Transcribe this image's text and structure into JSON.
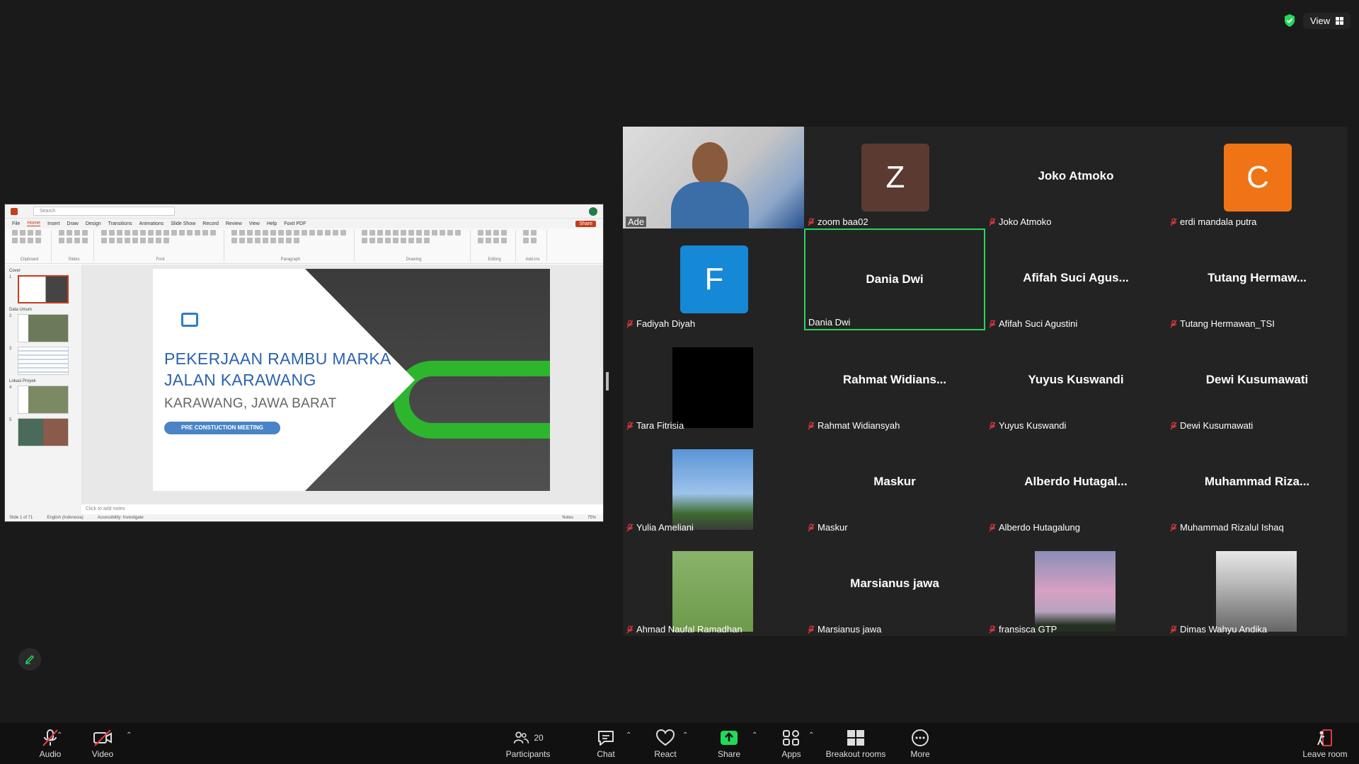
{
  "topbar": {
    "view_label": "View"
  },
  "shared_screen": {
    "app": {
      "search_placeholder": "Search",
      "tabs": [
        "File",
        "Home",
        "Insert",
        "Draw",
        "Design",
        "Transitions",
        "Animations",
        "Slide Show",
        "Record",
        "Review",
        "View",
        "Help",
        "Foxit PDF"
      ],
      "active_tab": "Home",
      "share_label": "Share",
      "ribbon_groups": [
        "Clipboard",
        "Slides",
        "Font",
        "Paragraph",
        "Drawing",
        "Editing",
        "Add-ins"
      ],
      "sections": [
        "Cover",
        "Data Umum",
        "Lokasi Proyek"
      ],
      "notes_placeholder": "Click to add notes",
      "status": {
        "slide": "Slide 1 of 71",
        "language": "English (Indonesia)",
        "accessibility": "Accessibility: Investigate",
        "notes": "Notes",
        "zoom": "75%"
      }
    },
    "slide": {
      "title_line1": "PEKERJAAN RAMBU MARKA",
      "title_line2": "JALAN KARAWANG",
      "subtitle": "KARAWANG, JAWA BARAT",
      "pill": "PRE CONSTUCTION MEETING"
    }
  },
  "participants": [
    {
      "name": "Ade",
      "type": "video",
      "muted": false
    },
    {
      "name": "zoom baa02",
      "type": "avatar",
      "letter": "Z",
      "color": "#5b3a32",
      "muted": true
    },
    {
      "name": "Joko Atmoko",
      "type": "name",
      "display": "Joko Atmoko",
      "muted": true
    },
    {
      "name": "erdi mandala putra",
      "type": "avatar",
      "letter": "C",
      "color": "#f07415",
      "muted": true
    },
    {
      "name": "Fadiyah Diyah",
      "type": "avatar",
      "letter": "F",
      "color": "#1588d6",
      "muted": true
    },
    {
      "name": "Dania Dwi",
      "type": "name",
      "display": "Dania Dwi",
      "muted": false,
      "active": true
    },
    {
      "name": "Afifah Suci Agustini",
      "type": "name",
      "display": "Afifah  Suci  Agus...",
      "muted": true
    },
    {
      "name": "Tutang Hermawan_TSI",
      "type": "name",
      "display": "Tutang  Hermaw...",
      "muted": true
    },
    {
      "name": "Tara Fitrisia",
      "type": "photo",
      "style": "black",
      "muted": true
    },
    {
      "name": "Rahmat Widiansyah",
      "type": "name",
      "display": "Rahmat  Widians...",
      "muted": true
    },
    {
      "name": "Yuyus Kuswandi",
      "type": "name",
      "display": "Yuyus Kuswandi",
      "muted": true
    },
    {
      "name": "Dewi Kusumawati",
      "type": "name",
      "display": "Dewi Kusumawati",
      "muted": true
    },
    {
      "name": "Yulia Ameliani",
      "type": "photo",
      "style": "sky",
      "muted": true
    },
    {
      "name": "Maskur",
      "type": "name",
      "display": "Maskur",
      "muted": true
    },
    {
      "name": "Alberdo Hutagalung",
      "type": "name",
      "display": "Alberdo  Hutagal...",
      "muted": true
    },
    {
      "name": "Muhammad Rizalul Ishaq",
      "type": "name",
      "display": "Muhammad  Riza...",
      "muted": true
    },
    {
      "name": "Ahmad Naufal Ramadhan",
      "type": "photo",
      "style": "selfie",
      "muted": true
    },
    {
      "name": "Marsianus jawa",
      "type": "name",
      "display": "Marsianus jawa",
      "muted": true
    },
    {
      "name": "fransisca GTP",
      "type": "photo",
      "style": "dusk",
      "muted": true
    },
    {
      "name": "Dimas Wahyu Andika",
      "type": "photo",
      "style": "room",
      "muted": true
    }
  ],
  "toolbar": {
    "audio": "Audio",
    "video": "Video",
    "participants": "Participants",
    "participants_count": "20",
    "chat": "Chat",
    "react": "React",
    "share": "Share",
    "apps": "Apps",
    "breakout": "Breakout rooms",
    "more": "More",
    "leave": "Leave room"
  },
  "colors": {
    "active_speaker": "#23d959",
    "share_green": "#23d959",
    "muted_red": "#e0393e"
  }
}
